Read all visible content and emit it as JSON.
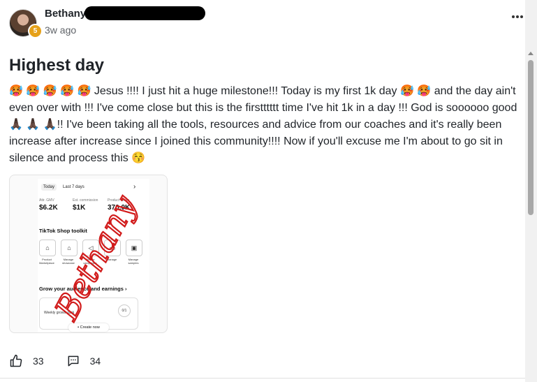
{
  "post": {
    "author": "Bethany",
    "level": "5",
    "time": "3w ago",
    "title": "Highest day",
    "body": "🥵 🥵 🥵 🥵 🥵 Jesus !!!! I just hit a huge milestone!!! Today is my first 1k day 🥵 🥵  and the day ain't even over with !!! I've come close but this is the firstttttt time I've hit 1k in a day !!! God is soooooo good 🙏🏿 🙏🏿 🙏🏿!! I've been taking all the tools, resources and advice from our coaches and it's really been increase after increase since I joined this community!!!! Now if you'll excuse me I'm about to go sit in silence and process this 😚",
    "likes": "33",
    "comments": "34"
  },
  "screenshot": {
    "tab_today": "Today",
    "tab_last7": "Last 7 days",
    "stats": [
      {
        "label": "Attr. GMV",
        "value": "$6.2K"
      },
      {
        "label": "Est. commission",
        "value": "$1K"
      },
      {
        "label": "Product views",
        "value": "370.0K"
      }
    ],
    "toolkit_title": "TikTok Shop toolkit",
    "tools": [
      "Product Marketplace",
      "Manage showcase",
      "Creator campaigns",
      "Manage",
      "Manage samples"
    ],
    "grow_title": "Grow your audience and earnings",
    "grow_text": "Weekly growth task",
    "grow_pill": "0/1",
    "create_now": "Create now",
    "watermark": "Bethany"
  },
  "colors": {
    "badge": "#e6a119",
    "watermark": "#d11a1a"
  }
}
